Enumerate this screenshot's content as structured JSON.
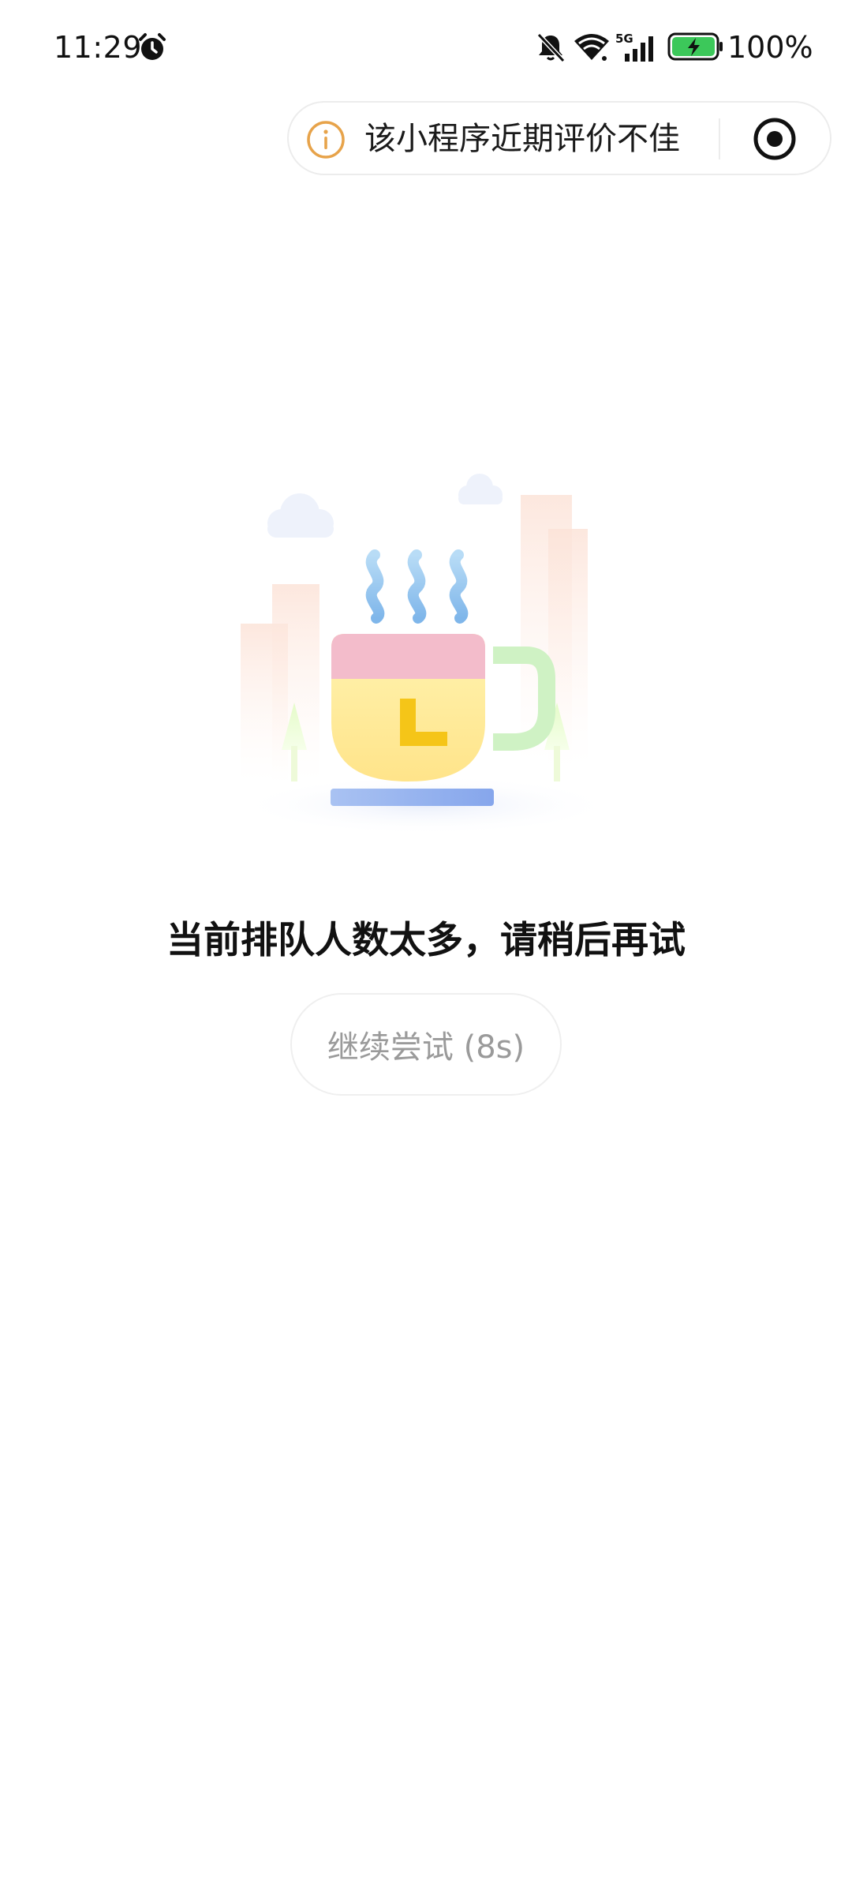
{
  "status_bar": {
    "time": "11:29",
    "battery_percent": "100%",
    "network_label": "5G",
    "icons": [
      "alarm-icon",
      "mute-icon",
      "wifi-icon",
      "signal-icon",
      "battery-charging-icon"
    ]
  },
  "capsule": {
    "notice_text": "该小程序近期评价不佳",
    "info_icon": "info-icon",
    "action_icon": "target-icon"
  },
  "illustration": {
    "icon": "coffee-cup-illustration",
    "cup_letter": "L"
  },
  "main": {
    "message": "当前排队人数太多，请稍后再试",
    "retry_label": "继续尝试 (8s)"
  },
  "colors": {
    "info_orange": "#E7A34A",
    "steam_blue": "#8EC5EE",
    "cup_pink": "#F3BCCB",
    "cup_yellow": "#FFEE9E",
    "handle_green": "#C9F0C0",
    "saucer_blue": "#8FAEEF",
    "letter_yellow": "#F5C518"
  }
}
